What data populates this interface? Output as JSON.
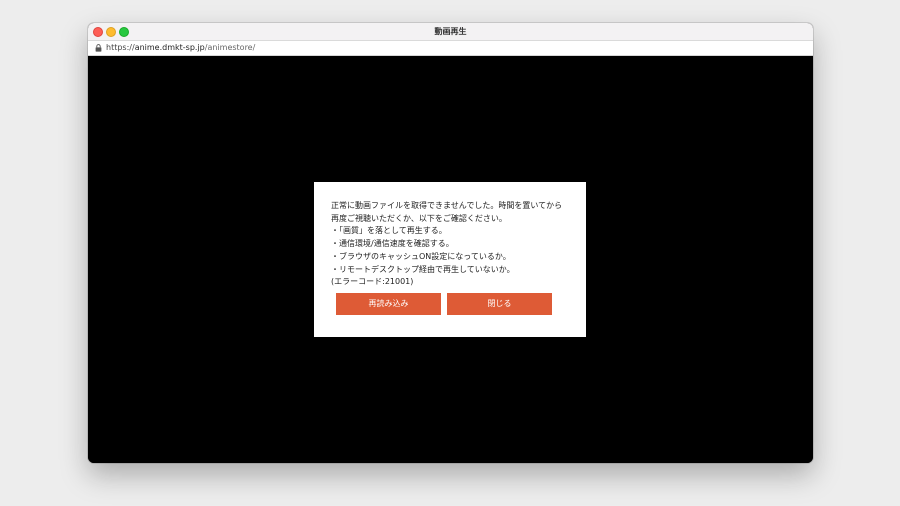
{
  "window": {
    "title": "動画再生"
  },
  "urlbar": {
    "scheme": "https://",
    "host": "anime.dmkt-sp.jp",
    "path": "/animestore/",
    "lock_icon": "lock-icon"
  },
  "dialog": {
    "lines": [
      "正常に動画ファイルを取得できませんでした。時間を置いてから",
      "再度ご視聴いただくか、以下をご確認ください。",
      "・「画質」を落として再生する。",
      "・通信環境/通信速度を確認する。",
      "・ブラウザのキャッシュON設定になっているか。",
      "・リモートデスクトップ経由で再生していないか。",
      "(エラーコード:21001)"
    ],
    "reload_label": "再読み込み",
    "close_label": "閉じる"
  },
  "colors": {
    "button": "#de5b36",
    "background": "#000000",
    "dialog": "#ffffff"
  }
}
